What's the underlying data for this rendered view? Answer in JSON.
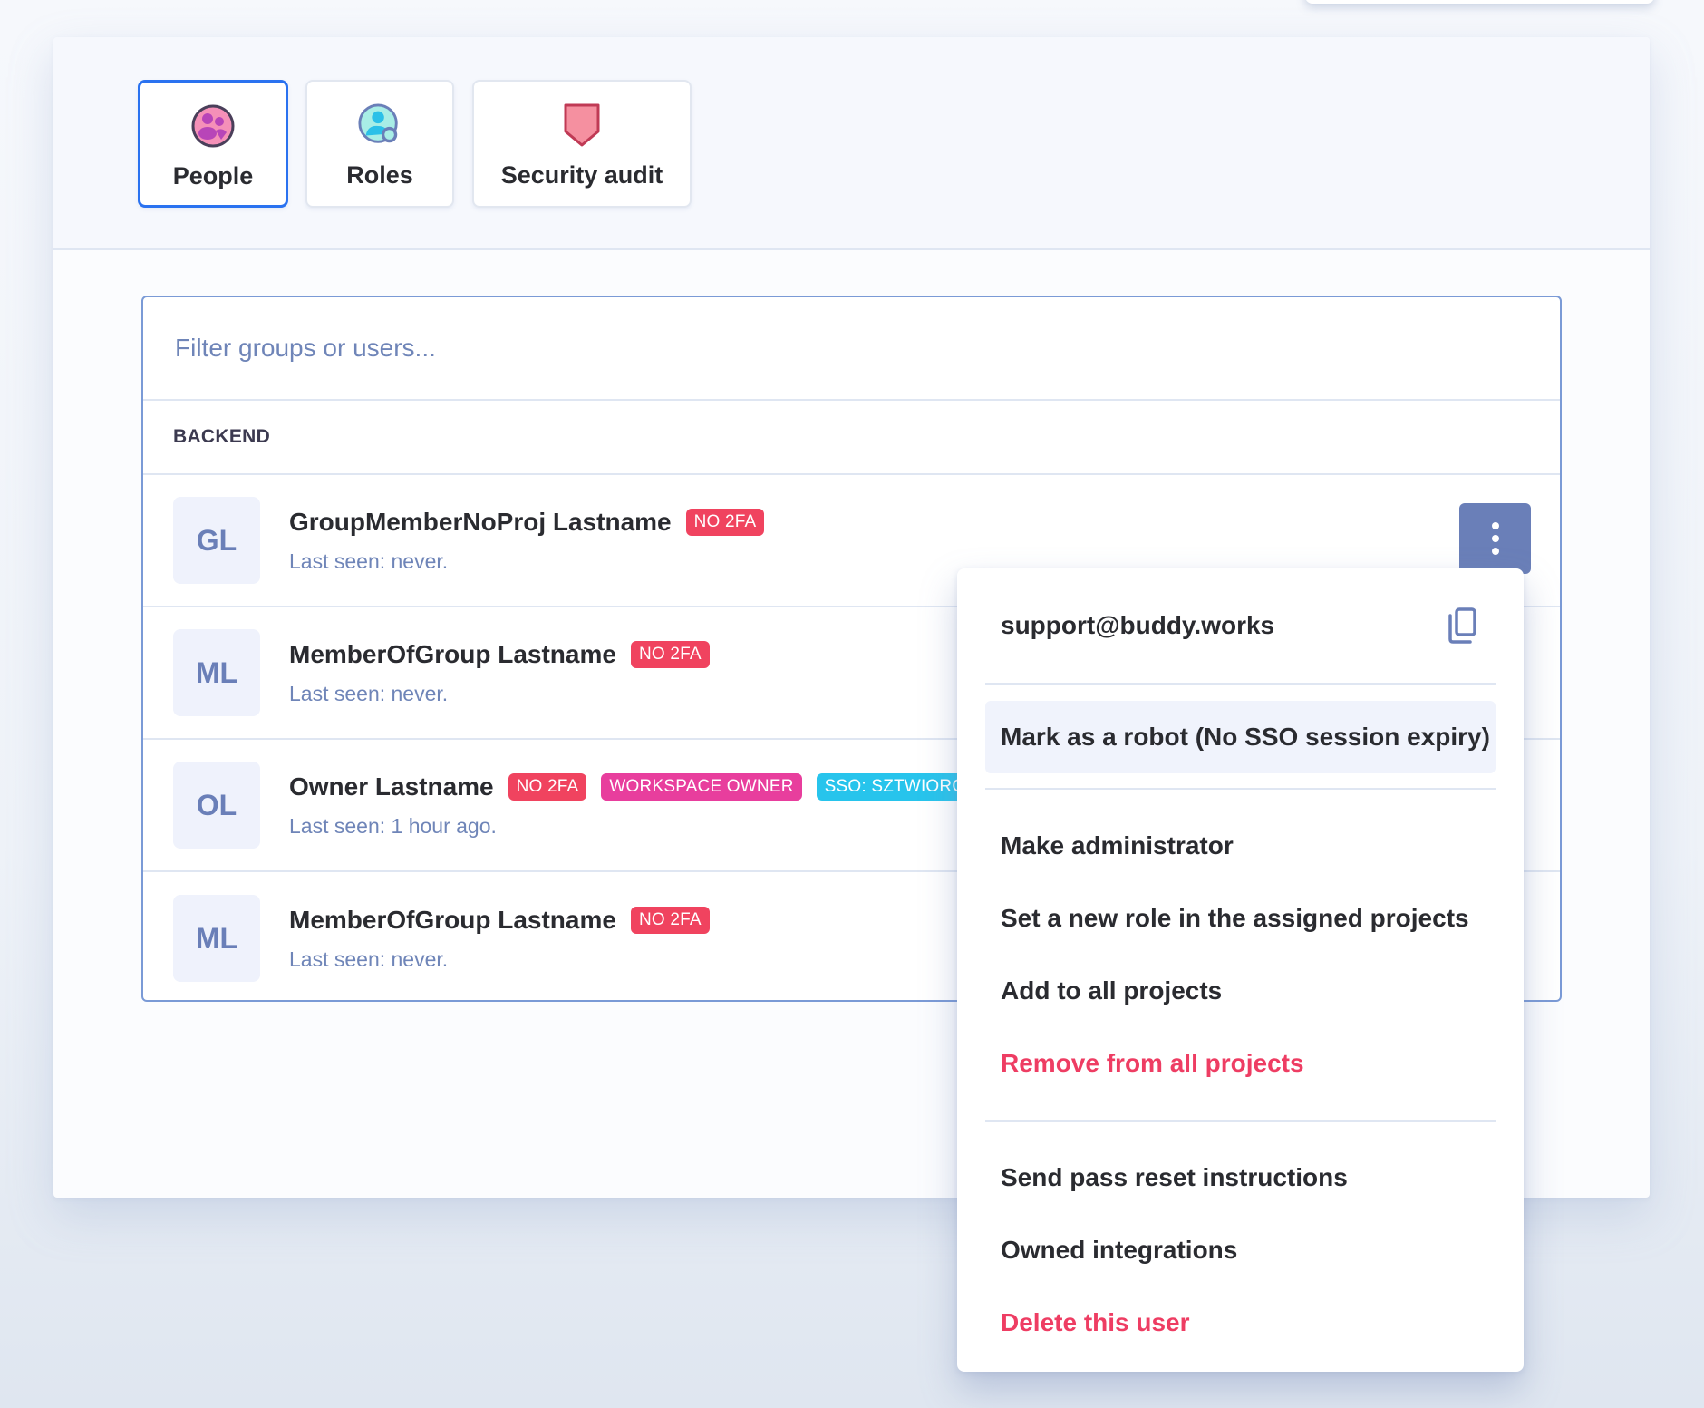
{
  "tabs": [
    {
      "label": "People",
      "icon": "people-icon",
      "active": true
    },
    {
      "label": "Roles",
      "icon": "roles-icon",
      "active": false
    },
    {
      "label": "Security audit",
      "icon": "shield-icon",
      "active": false
    }
  ],
  "filter": {
    "placeholder": "Filter groups or users...",
    "value": ""
  },
  "group": {
    "label": "BACKEND"
  },
  "users": [
    {
      "initials": "GL",
      "name": "GroupMemberNoProj Lastname",
      "badges": [
        "NO 2FA"
      ],
      "last_seen": "Last seen: never."
    },
    {
      "initials": "ML",
      "name": "MemberOfGroup Lastname",
      "badges": [
        "NO 2FA"
      ],
      "last_seen": "Last seen: never."
    },
    {
      "initials": "OL",
      "name": "Owner Lastname",
      "badges": [
        "NO 2FA",
        "WORKSPACE OWNER",
        "SSO: SZTWIORC"
      ],
      "last_seen": "Last seen: 1 hour ago."
    },
    {
      "initials": "ML",
      "name": "MemberOfGroup Lastname",
      "badges": [
        "NO 2FA"
      ],
      "last_seen": "Last seen: never."
    }
  ],
  "menu": {
    "email": "support@buddy.works",
    "highlighted": "Mark as a robot (No SSO session expiry)",
    "group1": [
      "Make administrator",
      "Set a new role in the assigned projects",
      "Add to all projects",
      "Remove from all projects"
    ],
    "group2": [
      "Send pass reset instructions",
      "Owned integrations",
      "Delete this user"
    ]
  },
  "colors": {
    "accent": "#2a72f0",
    "danger": "#ee3d63",
    "badge_no2fa": "#f0435f",
    "badge_owner": "#e83e9d",
    "badge_sso": "#27c4ec",
    "muted_blue": "#6a7fb8"
  }
}
